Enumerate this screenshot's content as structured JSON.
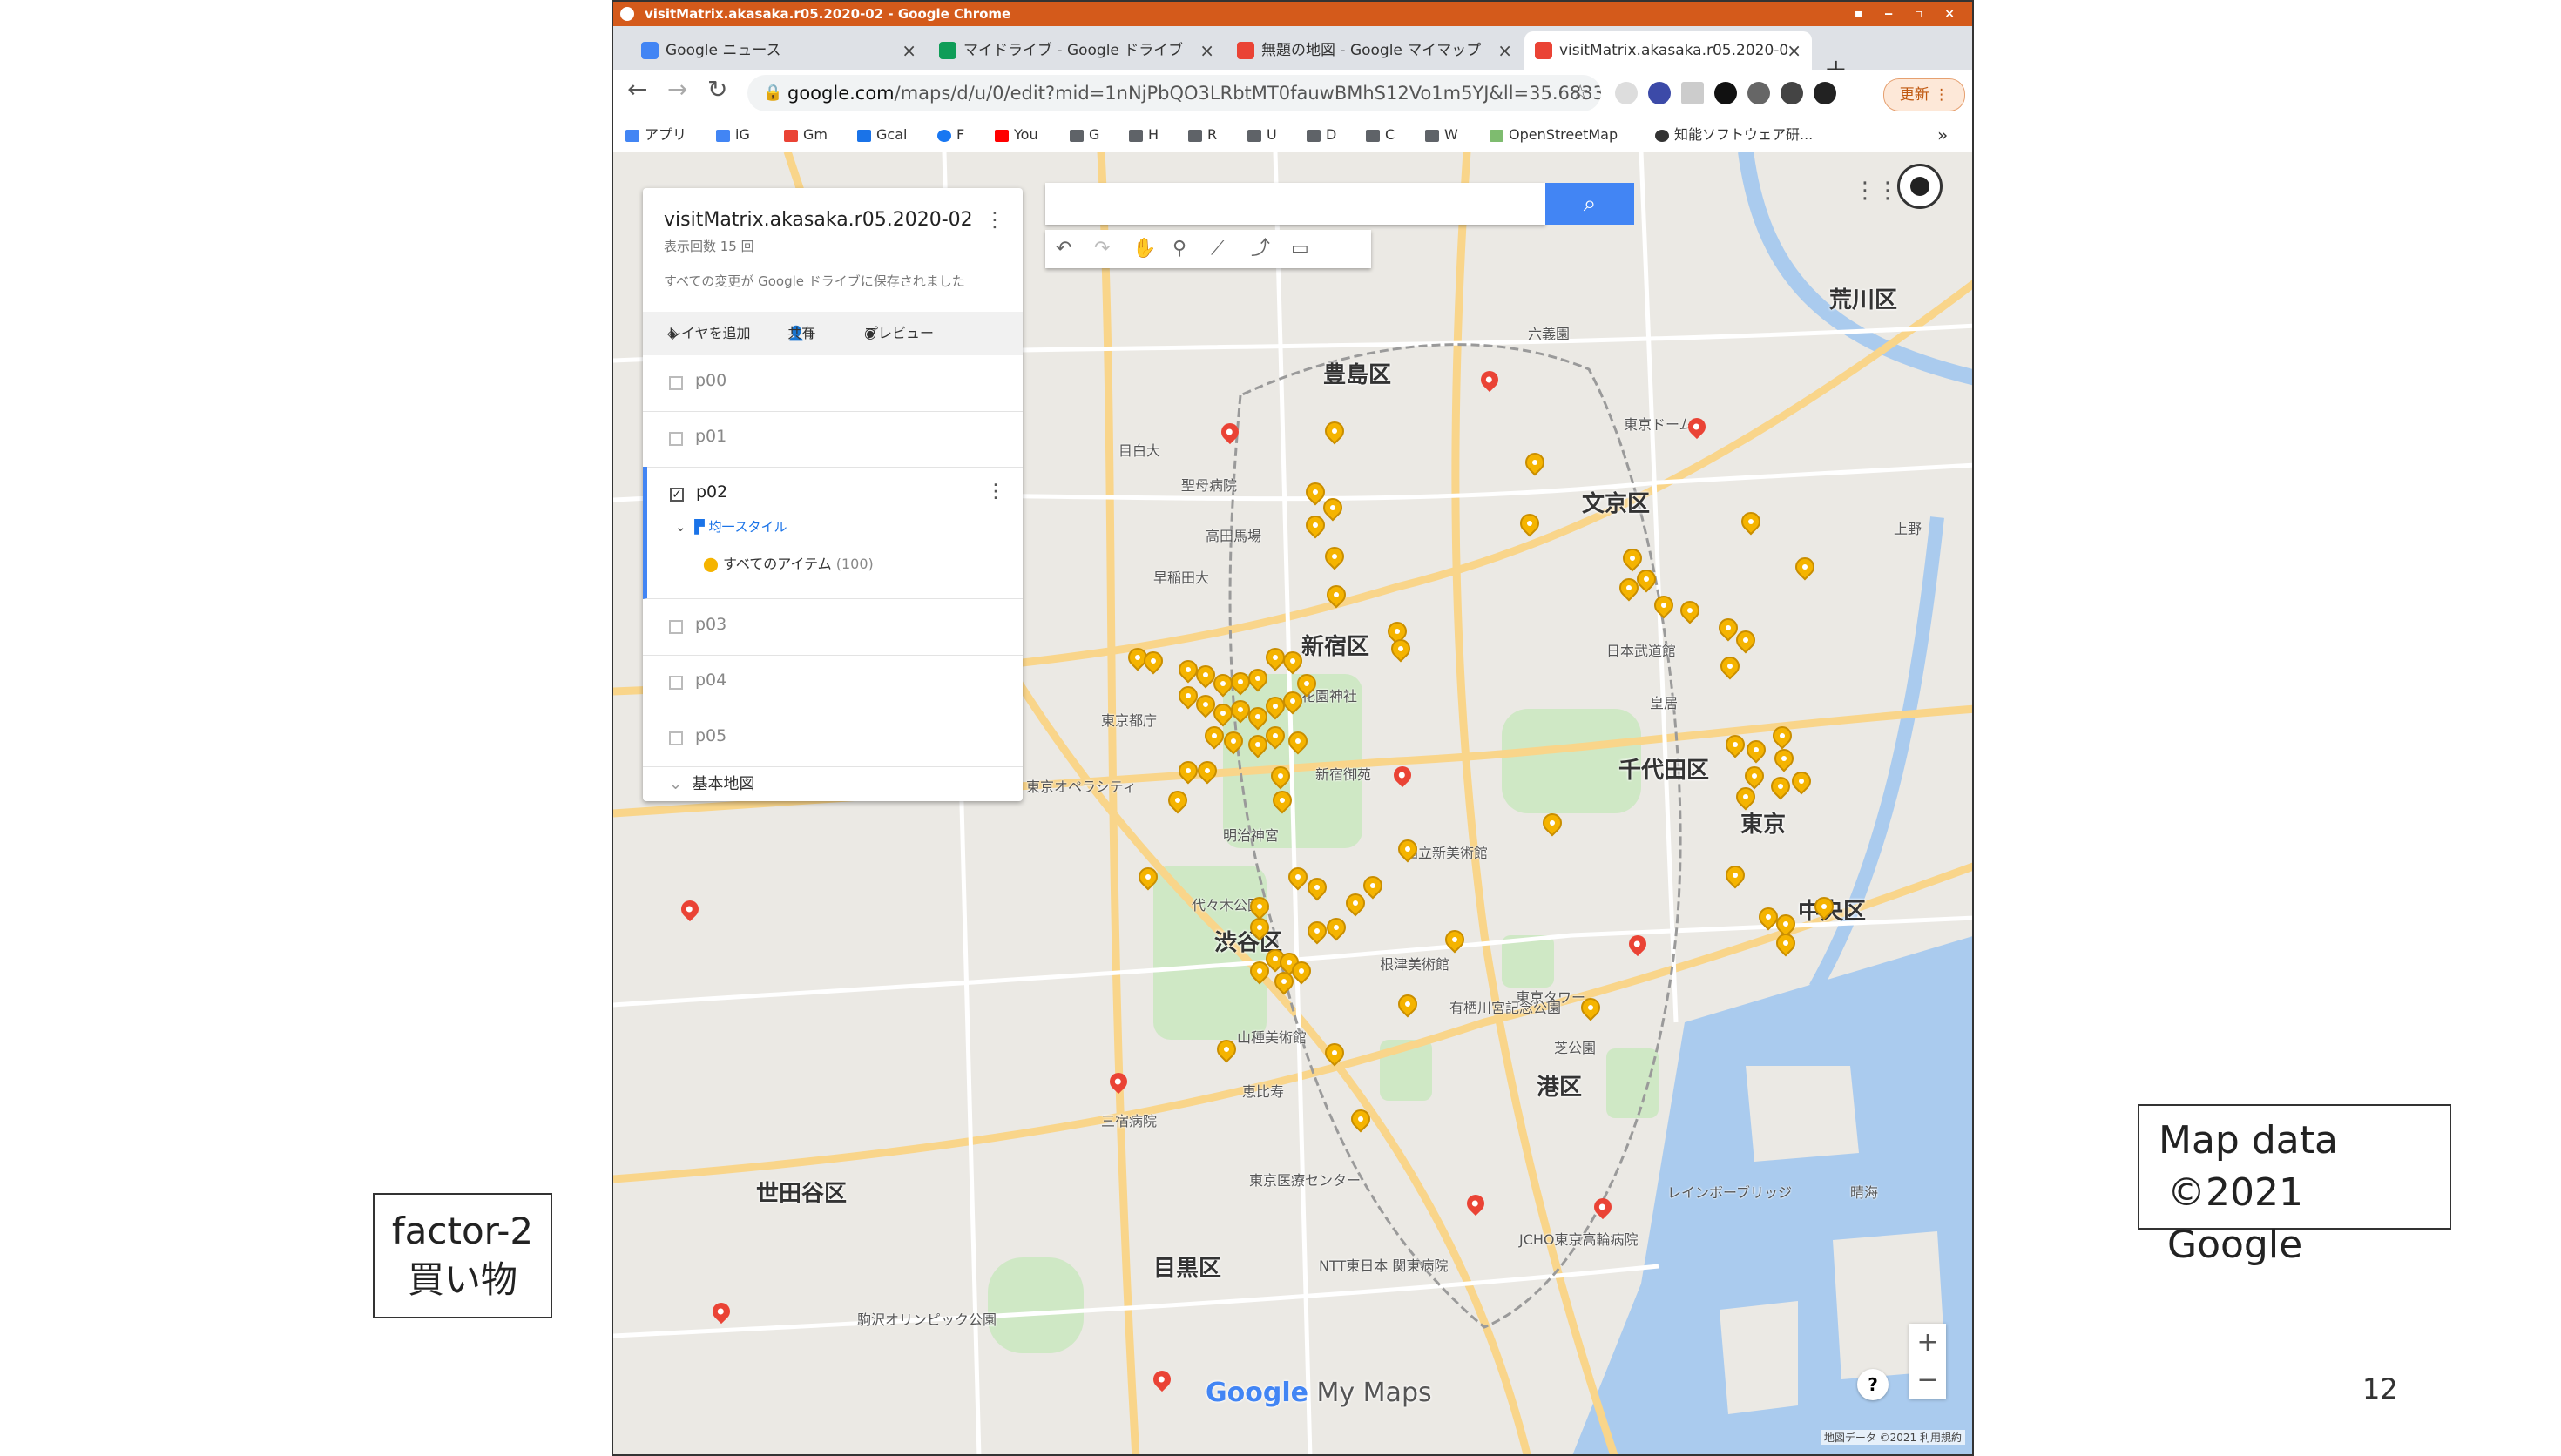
{
  "window": {
    "title": "visitMatrix.akasaka.r05.2020-02 - Google Chrome"
  },
  "tabs": [
    {
      "label": "Google ニュース",
      "color": "#4285f4"
    },
    {
      "label": "マイドライブ - Google ドライブ",
      "color": "#0f9d58"
    },
    {
      "label": "無題の地図 - Google マイマップ",
      "color": "#ea4335"
    },
    {
      "label": "visitMatrix.akasaka.r05.2020-0",
      "color": "#ea4335"
    }
  ],
  "address": {
    "host": "google.com",
    "path": "/maps/d/u/0/edit?mid=1nNjPbQO3LRbtMT0fauwBMhS12Vo1m5YJ&ll=35.6833...",
    "update_label": "更新"
  },
  "bookmarks": [
    "アプリ",
    "iG",
    "Gm",
    "Gcal",
    "F",
    "You",
    "G",
    "H",
    "R",
    "U",
    "D",
    "C",
    "W",
    "OpenStreetMap",
    "知能ソフトウェア研..."
  ],
  "panel": {
    "map_title": "visitMatrix.akasaka.r05.2020-02",
    "views": "表示回数 15 回",
    "saved_status": "すべての変更が Google ドライブに保存されました",
    "actions": {
      "add_layer": "レイヤを追加",
      "share": "共有",
      "preview": "プレビュー"
    },
    "layers": [
      {
        "name": "p00",
        "checked": false
      },
      {
        "name": "p01",
        "checked": false
      },
      {
        "name": "p02",
        "checked": true,
        "style": "均一スタイル",
        "items_label": "すべてのアイテム",
        "items_count": "(100)"
      },
      {
        "name": "p03",
        "checked": false
      },
      {
        "name": "p04",
        "checked": false
      },
      {
        "name": "p05",
        "checked": false
      }
    ],
    "base_map": "基本地図"
  },
  "map": {
    "wards": [
      "豊島区",
      "荒川区",
      "文京区",
      "新宿区",
      "千代田区",
      "東京",
      "中央区",
      "渋谷区",
      "港区",
      "世田谷区",
      "目黒区"
    ],
    "places": [
      "東京都庁",
      "花園神社",
      "聖母病院",
      "高田馬場",
      "新宿御苑",
      "代々木公園",
      "恵比寿",
      "根津美術館",
      "東京タワー",
      "芝公園",
      "国立新美術館",
      "東京オペラシティ",
      "三宿病院",
      "NTT東日本 関東病院",
      "JCHO東京高輪病院",
      "駒沢オリンピック公園",
      "東京ドーム",
      "上野",
      "六義園",
      "目白大",
      "早稲田大",
      "明治神宮",
      "皇居",
      "日本武道館",
      "有栖川宮記念公園",
      "山種美術館",
      "東京医療センター",
      "レインボーブリッジ",
      "晴海"
    ],
    "brand": "My Maps",
    "attribution": "地図データ ©2021  利用規約",
    "pin_color": "#f5b400"
  },
  "slide": {
    "factor_line1": "factor-2",
    "factor_line2": "買い物",
    "mapdata_line1": "Map data",
    "mapdata_line2": "©2021 Google",
    "page_number": "12"
  }
}
